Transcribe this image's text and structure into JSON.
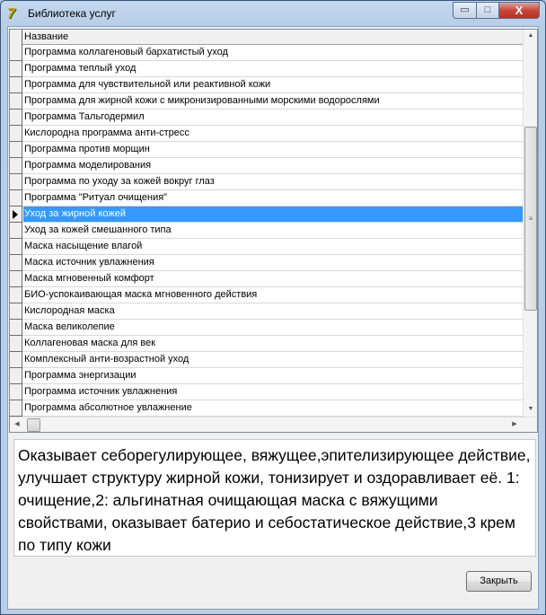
{
  "window": {
    "title": "Библиотека услуг",
    "minimize": "▭",
    "maximize": "□",
    "close": "X"
  },
  "grid": {
    "column_header": "Название",
    "selected_index": 10,
    "rows": [
      "Программа коллагеновый бархатистый уход",
      "Программа теплый уход",
      "Программа для чувствительной или реактивной кожи",
      "Программа для жирной кожи с микронизированными морскими водорослями",
      "Программа Тальгодермил",
      "Кислородна программа анти-стресс",
      "Программа против морщин",
      "Программа моделирования",
      "Программа по уходу за кожей вокруг глаз",
      "Программа \"Ритуал очищения\"",
      "Уход за жирной кожей",
      "Уход за кожей смешанного типа",
      "Маска насыщение влагой",
      "Маска источник увлажнения",
      "Маска мгновенный комфорт",
      "БИО-успокаивающая маска мгновенного действия",
      "Кислородная маска",
      "Маска великолепие",
      "Коллагеновая маска для век",
      "Комплексный анти-возрастной уход",
      "Программа энергизации",
      "Программа источник увлажнения",
      "Программа абсолютное увлажнение"
    ]
  },
  "description": "Оказывает себорегулирующее, вяжущее,эпителизирующее действие, улучшает структуру жирной кожи, тонизирует и оздоравливает её. 1: очищение,2: альгинатная очищающая маска с вяжущими свойствами, оказывает батерио и себостатическое действие,3 крем по типу кожи",
  "buttons": {
    "close": "Закрыть"
  }
}
